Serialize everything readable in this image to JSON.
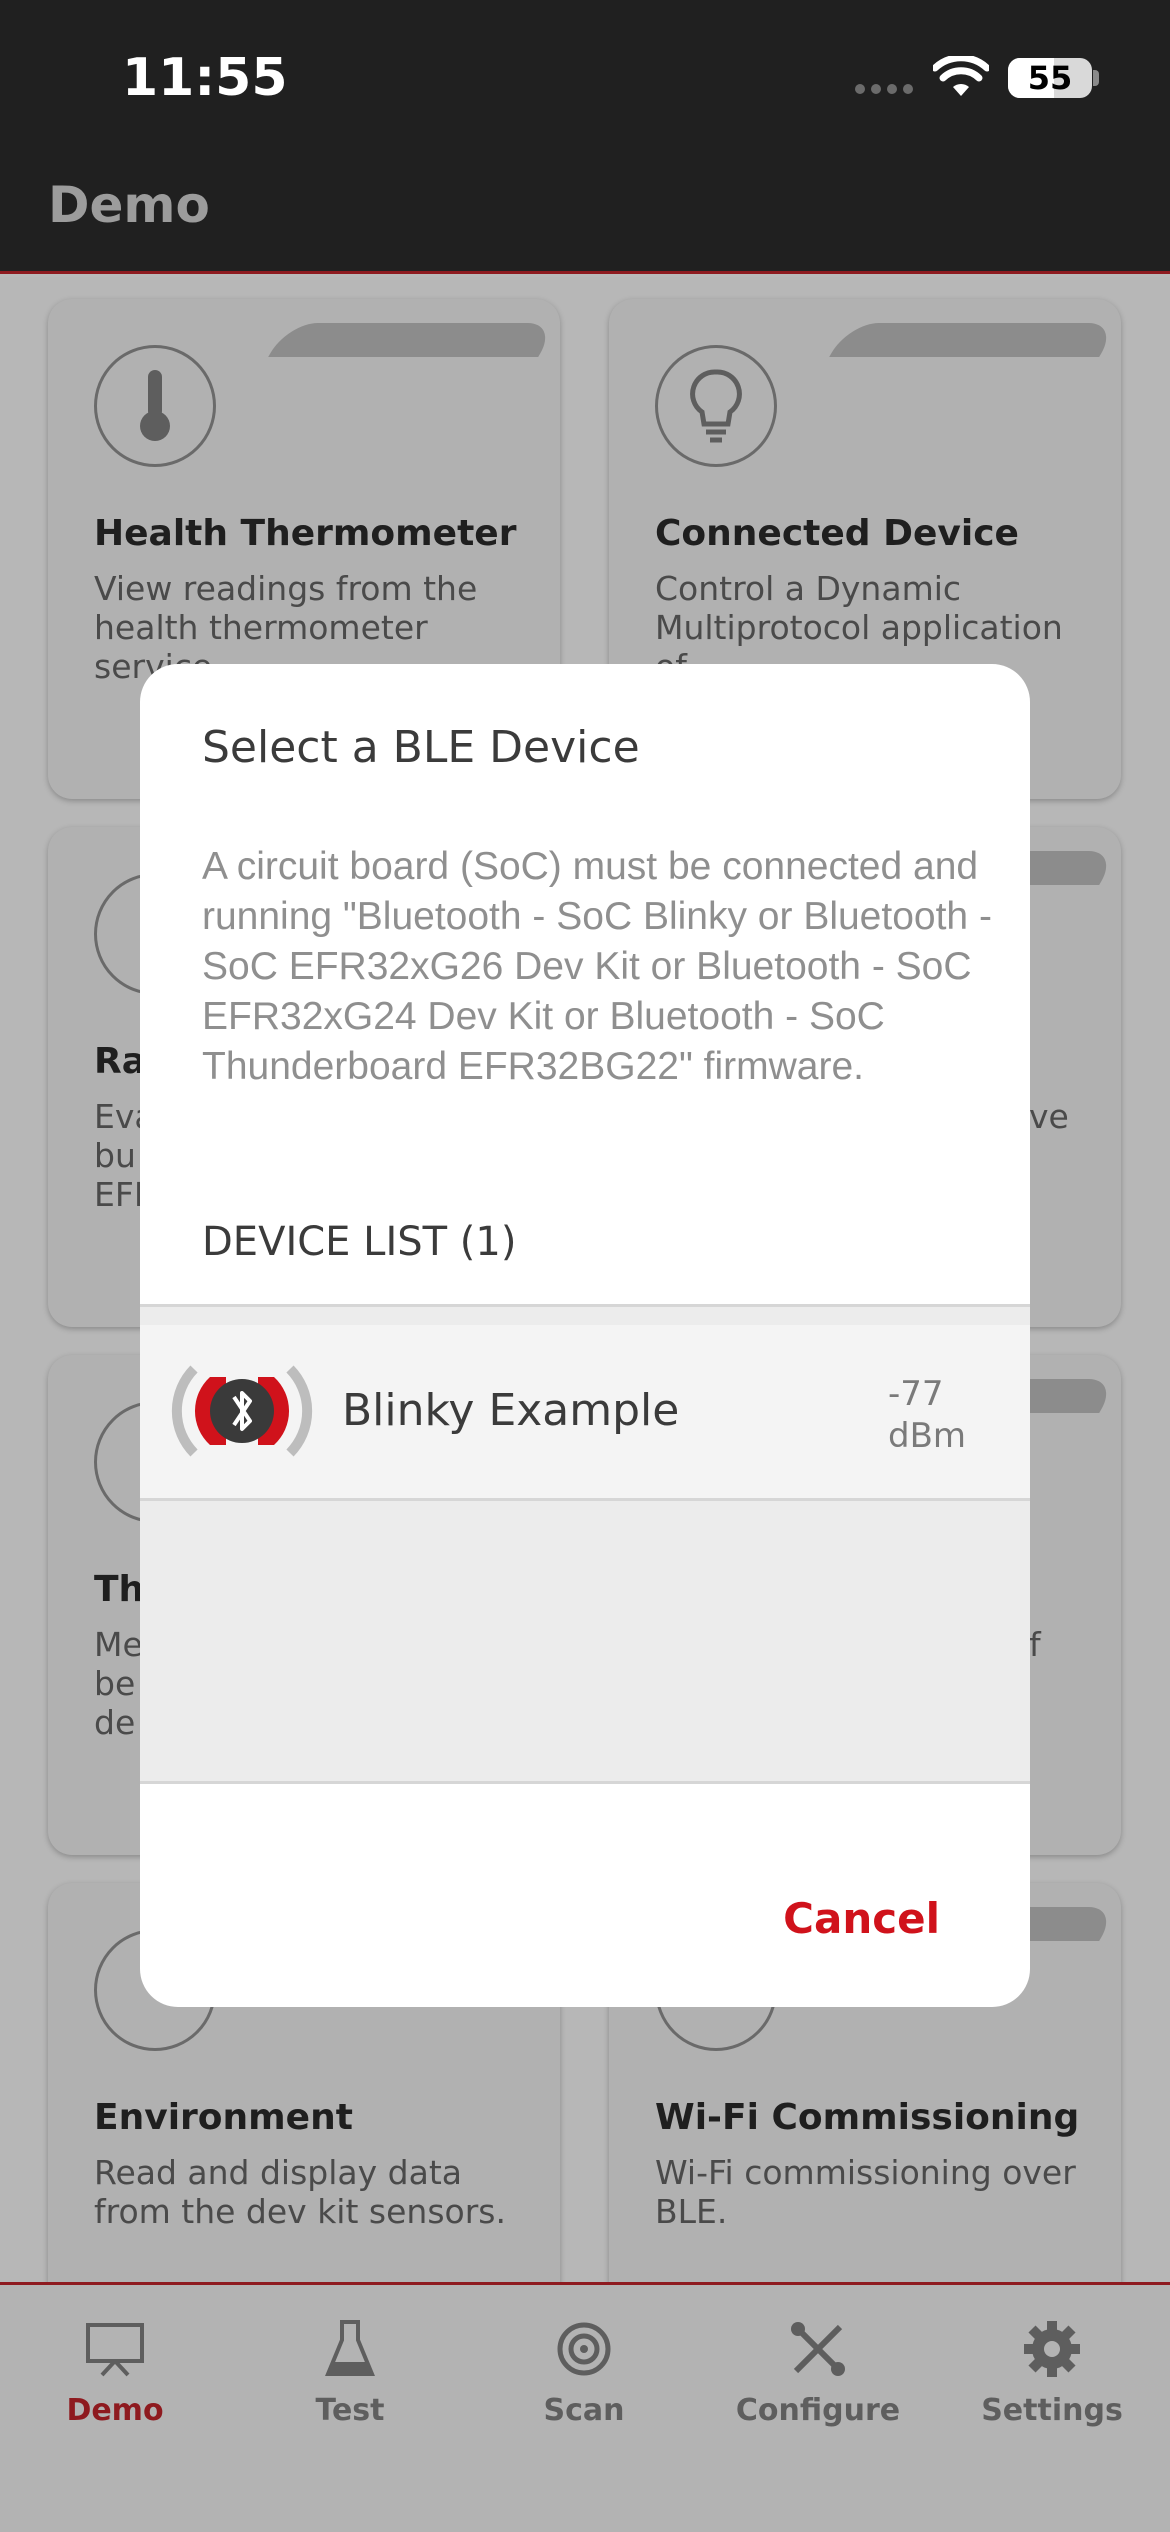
{
  "status_bar": {
    "time": "11:55",
    "battery": "55",
    "battery_level": 0.55
  },
  "header": {
    "title": "Demo"
  },
  "cards": [
    {
      "title": "Health Thermometer",
      "desc": "View readings from the health thermometer service.",
      "icon": "thermometer-icon"
    },
    {
      "title": "Connected Device",
      "desc": "Control a Dynamic Multiprotocol application of",
      "icon": "lightbulb-icon"
    },
    {
      "title": "Ra",
      "desc": "Eva bu EFI",
      "icon": "gauge-icon"
    },
    {
      "title": "",
      "desc": "ve",
      "icon": ""
    },
    {
      "title": "Th",
      "desc": "Me be de",
      "icon": "meter-icon"
    },
    {
      "title": "",
      "desc": "f",
      "icon": ""
    },
    {
      "title": "Environment",
      "desc": "Read and display data from the dev kit sensors.",
      "icon": "environment-icon"
    },
    {
      "title": "Wi-Fi Commissioning",
      "desc": "Wi-Fi commissioning over BLE.",
      "icon": "wifi-icon"
    }
  ],
  "dialog": {
    "title": "Select a BLE Device",
    "message": "A circuit board (SoC) must be connected and running \"Bluetooth - SoC Blinky or Bluetooth - SoC EFR32xG26 Dev Kit or Bluetooth - SoC EFR32xG24 Dev Kit or Bluetooth - SoC Thunderboard EFR32BG22\" firmware.",
    "list_header": "DEVICE LIST (1)",
    "devices": [
      {
        "name": "Blinky Example",
        "rssi_value": "-77",
        "rssi_unit": "dBm",
        "icon": "bluetooth-icon"
      }
    ],
    "cancel_label": "Cancel"
  },
  "tabs": [
    {
      "label": "Demo",
      "icon": "presentation-icon",
      "active": true
    },
    {
      "label": "Test",
      "icon": "flask-icon",
      "active": false
    },
    {
      "label": "Scan",
      "icon": "scan-icon",
      "active": false
    },
    {
      "label": "Configure",
      "icon": "tools-icon",
      "active": false
    },
    {
      "label": "Settings",
      "icon": "gear-icon",
      "active": false
    }
  ],
  "colors": {
    "accent": "#d0121b",
    "header_bg": "#202020",
    "active_tab": "#8e1a1f"
  }
}
